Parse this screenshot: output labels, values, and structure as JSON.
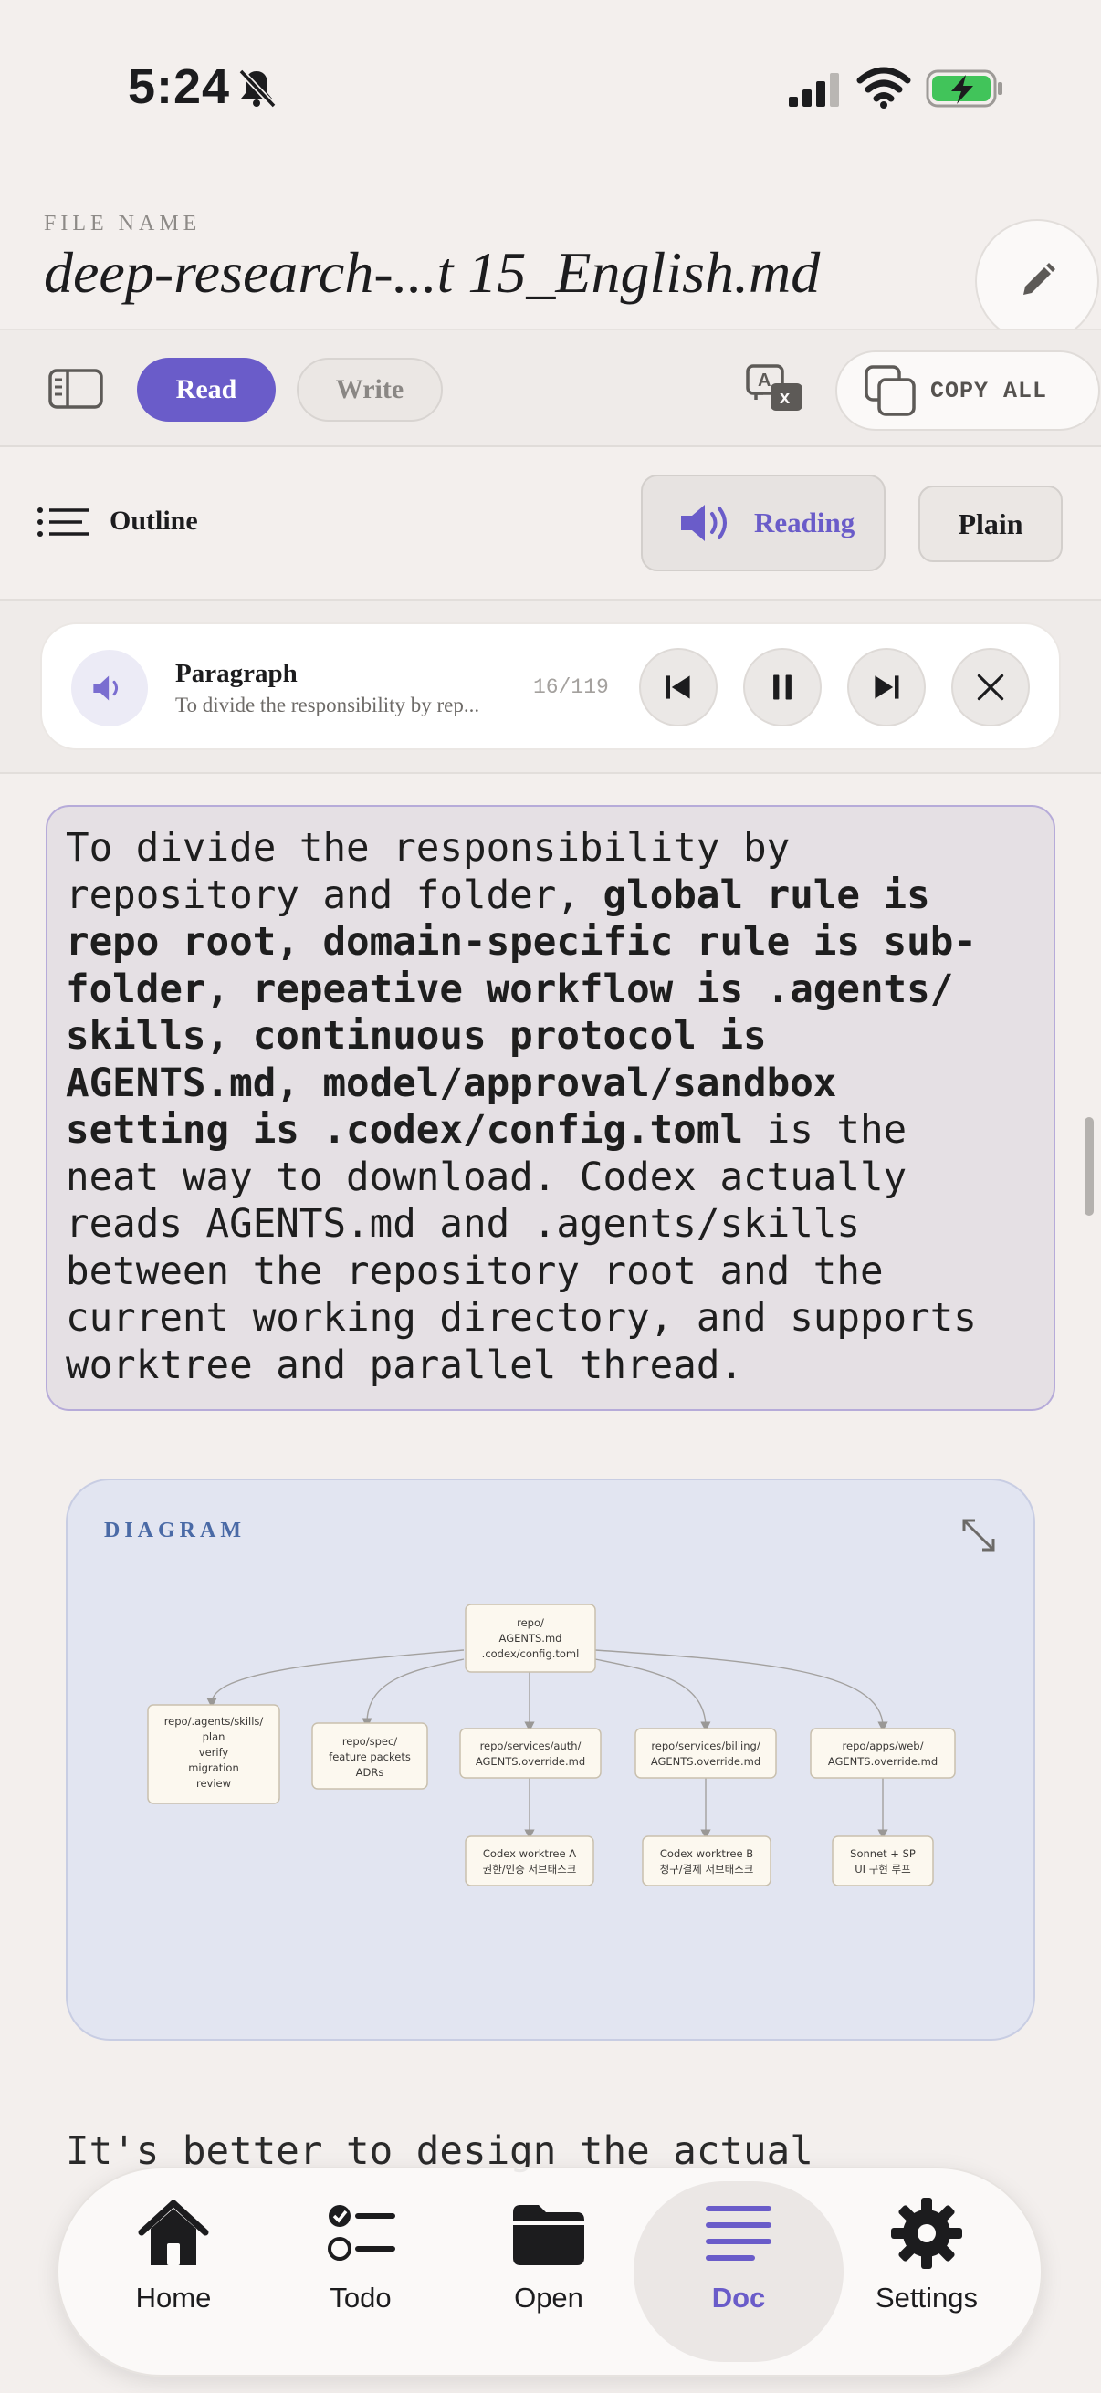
{
  "status_bar": {
    "time": "5:24"
  },
  "header": {
    "file_label": "FILE NAME",
    "file_name": "deep-research-...t 15_English.md"
  },
  "toolbar": {
    "read_label": "Read",
    "write_label": "Write",
    "copy_all_label": "COPY ALL"
  },
  "outline_row": {
    "outline_label": "Outline",
    "reading_label": "Reading",
    "plain_label": "Plain"
  },
  "player": {
    "title": "Paragraph",
    "subtitle": "To divide the responsibility by rep...",
    "counter": "16/119"
  },
  "paragraph": {
    "segments": [
      {
        "text": "To divide the responsibility by\nrepository and folder, ",
        "bold": false
      },
      {
        "text": "global rule is\nrepo root, domain-specific rule is sub-\nfolder, repeative workflow is .agents/\nskills, continuous protocol is\nAGENTS.md, model/approval/sandbox\nsetting is .codex/config.toml",
        "bold": true
      },
      {
        "text": " is the\nneat way to download. Codex actually\nreads AGENTS.md and .agents/skills\nbetween the repository root and the\ncurrent working directory, and supports\nworktree and parallel thread.",
        "bold": false
      }
    ]
  },
  "diagram": {
    "label": "DIAGRAM",
    "nodes": {
      "root": [
        "repo/",
        "AGENTS.md",
        ".codex/config.toml"
      ],
      "skills": [
        "repo/.agents/skills/",
        "plan",
        "verify",
        "migration",
        "review"
      ],
      "spec": [
        "repo/spec/",
        "feature packets",
        "ADRs"
      ],
      "auth": [
        "repo/services/auth/",
        "AGENTS.override.md"
      ],
      "billing": [
        "repo/services/billing/",
        "AGENTS.override.md"
      ],
      "web": [
        "repo/apps/web/",
        "AGENTS.override.md"
      ],
      "worktree_a": [
        "Codex worktree A",
        "권한/인증 서브태스크"
      ],
      "worktree_b": [
        "Codex worktree B",
        "청구/결제 서브태스크"
      ],
      "sonnet": [
        "Sonnet + SP",
        "UI 구현 루프"
      ]
    }
  },
  "next_paragraph": {
    "text": "It's better to design the actual"
  },
  "tabbar": {
    "tabs": [
      {
        "label": "Home",
        "icon": "house-icon"
      },
      {
        "label": "Todo",
        "icon": "checklist-icon"
      },
      {
        "label": "Open",
        "icon": "folder-icon"
      },
      {
        "label": "Doc",
        "icon": "lines-icon",
        "active": true
      },
      {
        "label": "Settings",
        "icon": "gear-icon"
      }
    ]
  },
  "colors": {
    "accent": "#6a5cc9",
    "background": "#f3efed",
    "diagram_bg": "#e2e5f1",
    "highlight_bg": "#e5e0e4"
  }
}
